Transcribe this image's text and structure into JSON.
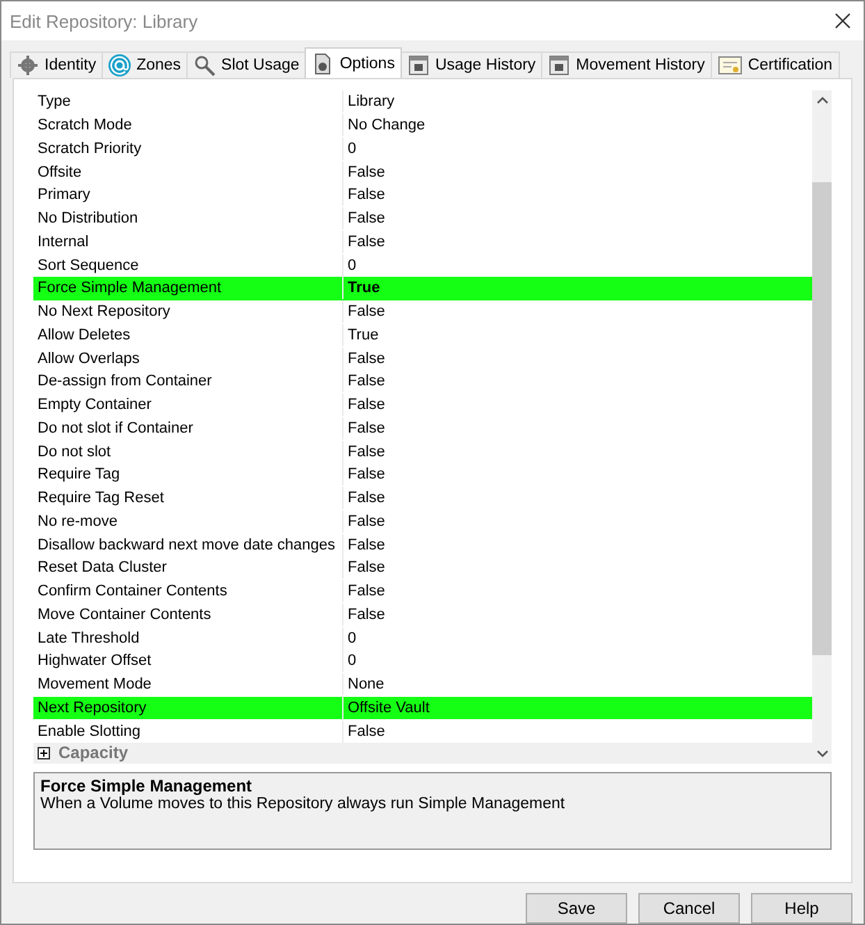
{
  "window": {
    "title": "Edit Repository: Library"
  },
  "tabs": [
    {
      "label": "Identity",
      "selected": false
    },
    {
      "label": "Zones",
      "selected": false
    },
    {
      "label": "Slot Usage",
      "selected": false
    },
    {
      "label": "Options",
      "selected": true
    },
    {
      "label": "Usage History",
      "selected": false
    },
    {
      "label": "Movement History",
      "selected": false
    },
    {
      "label": "Certification",
      "selected": false
    }
  ],
  "properties": [
    {
      "name": "Type",
      "value": "Library",
      "highlighted": false,
      "bold": false
    },
    {
      "name": "Scratch Mode",
      "value": "No Change",
      "highlighted": false,
      "bold": false
    },
    {
      "name": "Scratch Priority",
      "value": "0",
      "highlighted": false,
      "bold": false
    },
    {
      "name": "Offsite",
      "value": "False",
      "highlighted": false,
      "bold": false
    },
    {
      "name": "Primary",
      "value": "False",
      "highlighted": false,
      "bold": false
    },
    {
      "name": "No Distribution",
      "value": "False",
      "highlighted": false,
      "bold": false
    },
    {
      "name": "Internal",
      "value": "False",
      "highlighted": false,
      "bold": false
    },
    {
      "name": "Sort Sequence",
      "value": "0",
      "highlighted": false,
      "bold": false
    },
    {
      "name": "Force Simple Management",
      "value": "True",
      "highlighted": true,
      "bold": true
    },
    {
      "name": "No Next Repository",
      "value": "False",
      "highlighted": false,
      "bold": false
    },
    {
      "name": "Allow Deletes",
      "value": "True",
      "highlighted": false,
      "bold": false
    },
    {
      "name": "Allow Overlaps",
      "value": "False",
      "highlighted": false,
      "bold": false
    },
    {
      "name": "De-assign from Container",
      "value": "False",
      "highlighted": false,
      "bold": false
    },
    {
      "name": "Empty Container",
      "value": "False",
      "highlighted": false,
      "bold": false
    },
    {
      "name": "Do not slot if Container",
      "value": "False",
      "highlighted": false,
      "bold": false
    },
    {
      "name": "Do not slot",
      "value": "False",
      "highlighted": false,
      "bold": false
    },
    {
      "name": "Require Tag",
      "value": "False",
      "highlighted": false,
      "bold": false
    },
    {
      "name": "Require Tag Reset",
      "value": "False",
      "highlighted": false,
      "bold": false
    },
    {
      "name": "No re-move",
      "value": "False",
      "highlighted": false,
      "bold": false
    },
    {
      "name": "Disallow backward next move date changes",
      "value": "False",
      "highlighted": false,
      "bold": false
    },
    {
      "name": "Reset Data Cluster",
      "value": "False",
      "highlighted": false,
      "bold": false
    },
    {
      "name": "Confirm Container Contents",
      "value": "False",
      "highlighted": false,
      "bold": false
    },
    {
      "name": "Move Container Contents",
      "value": "False",
      "highlighted": false,
      "bold": false
    },
    {
      "name": "Late Threshold",
      "value": "0",
      "highlighted": false,
      "bold": false
    },
    {
      "name": "Highwater Offset",
      "value": "0",
      "highlighted": false,
      "bold": false
    },
    {
      "name": "Movement Mode",
      "value": "None",
      "highlighted": false,
      "bold": false
    },
    {
      "name": "Next Repository",
      "value": "Offsite Vault",
      "highlighted": true,
      "bold": false
    },
    {
      "name": "Enable Slotting",
      "value": "False",
      "highlighted": false,
      "bold": false
    }
  ],
  "categories": [
    {
      "label": "Capacity",
      "expanded": false
    }
  ],
  "description": {
    "title": "Force Simple Management",
    "text": "When a Volume moves to this Repository always run Simple Management"
  },
  "buttons": [
    "Save",
    "Cancel",
    "Help"
  ]
}
